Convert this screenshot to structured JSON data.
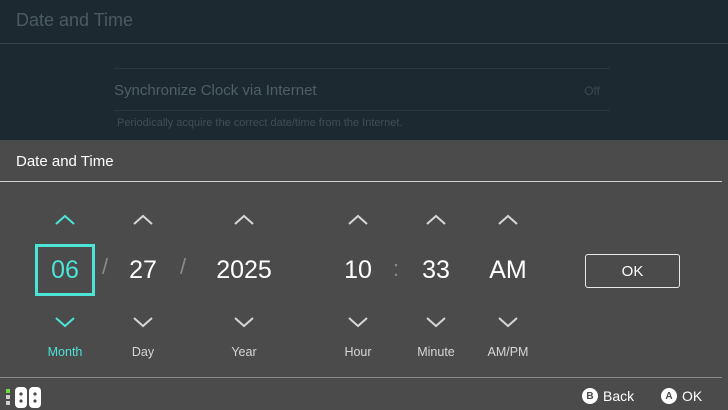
{
  "background": {
    "title": "Date and Time",
    "row_label": "Synchronize Clock via Internet",
    "row_value": "Off",
    "description": "Periodically acquire the correct date/time from the Internet."
  },
  "dialog": {
    "title": "Date and Time",
    "fields": [
      {
        "label": "Month",
        "value": "06",
        "selected": true
      },
      {
        "label": "Day",
        "value": "27",
        "selected": false
      },
      {
        "label": "Year",
        "value": "2025",
        "selected": false
      },
      {
        "label": "Hour",
        "value": "10",
        "selected": false
      },
      {
        "label": "Minute",
        "value": "33",
        "selected": false
      },
      {
        "label": "AM/PM",
        "value": "AM",
        "selected": false
      }
    ],
    "separators": [
      "/",
      "/",
      ":"
    ],
    "ok_label": "OK"
  },
  "footer": {
    "back_button": "B",
    "back_label": "Back",
    "ok_button": "A",
    "ok_label": "OK"
  },
  "colors": {
    "accent": "#4be4d7",
    "panel": "#4b4b4b",
    "background": "#1d2930"
  }
}
